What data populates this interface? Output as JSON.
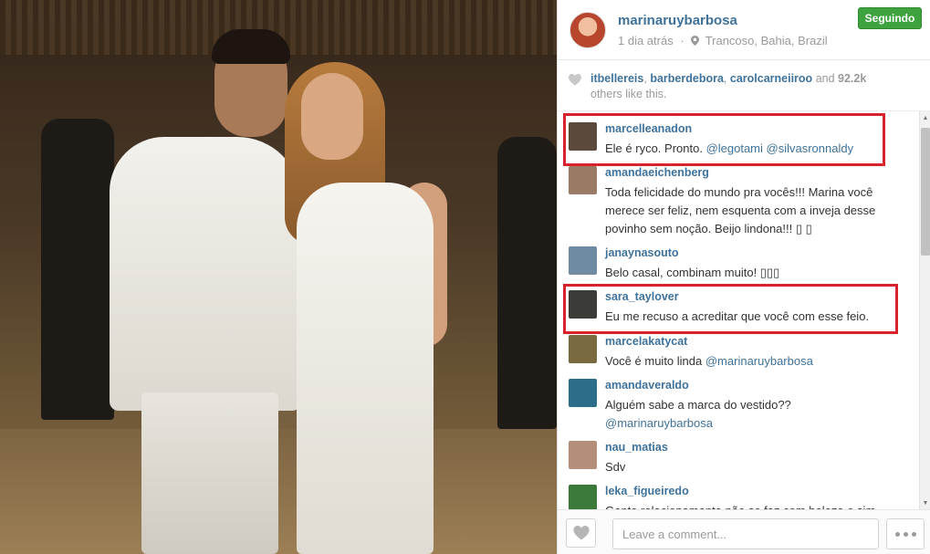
{
  "post": {
    "username": "marinaruybarbosa",
    "time": "1 dia atrás",
    "location": "Trancoso, Bahia, Brazil",
    "follow_label": "Seguindo",
    "colors": {
      "link": "#3f729b",
      "follow": "#3ea33e",
      "highlight": "#d9232a"
    }
  },
  "likes": {
    "users": [
      "itbellereis",
      "barberdebora",
      "carolcarneiiroo"
    ],
    "and_text": "and",
    "count": "92.2k",
    "suffix": "others like this."
  },
  "comments": [
    {
      "user": "marcelleanadon",
      "text": "Ele é ryco. Pronto. ",
      "mentions": "@legotami @silvasronnaldy",
      "avatar_color": "#5b4a3c"
    },
    {
      "user": "amandaeichenberg",
      "text": "Toda felicidade do mundo pra vocês!!! Marina você merece ser feliz, nem esquenta com a inveja desse povinho sem noção. Beijo lindona!!! ▯ ▯",
      "mentions": "",
      "avatar_color": "#9a7a64"
    },
    {
      "user": "janaynasouto",
      "text": "Belo casal, combinam muito! ▯▯▯",
      "mentions": "",
      "avatar_color": "#6f8aa3"
    },
    {
      "user": "sara_taylover",
      "text": "Eu me recuso a acreditar que você com esse feio.",
      "mentions": "",
      "avatar_color": "#3b3b38"
    },
    {
      "user": "marcelakatycat",
      "text": "Você é muito linda ",
      "mentions": "@marinaruybarbosa",
      "avatar_color": "#7a6a40"
    },
    {
      "user": "amandaveraldo",
      "text": "Alguém sabe a marca do vestido?? ",
      "mentions": "@marinaruybarbosa",
      "avatar_color": "#2c6e8a"
    },
    {
      "user": "nau_matias",
      "text": "Sdv",
      "mentions": "",
      "avatar_color": "#b38f7a"
    },
    {
      "user": "leka_figueiredo",
      "text": "Gente relacionamento não se faz com beleza e sim",
      "mentions": "",
      "avatar_color": "#3c7a3c"
    }
  ],
  "footer": {
    "comment_placeholder": "Leave a comment...",
    "like_icon": "heart-icon",
    "more_icon": "more-dots-icon"
  }
}
